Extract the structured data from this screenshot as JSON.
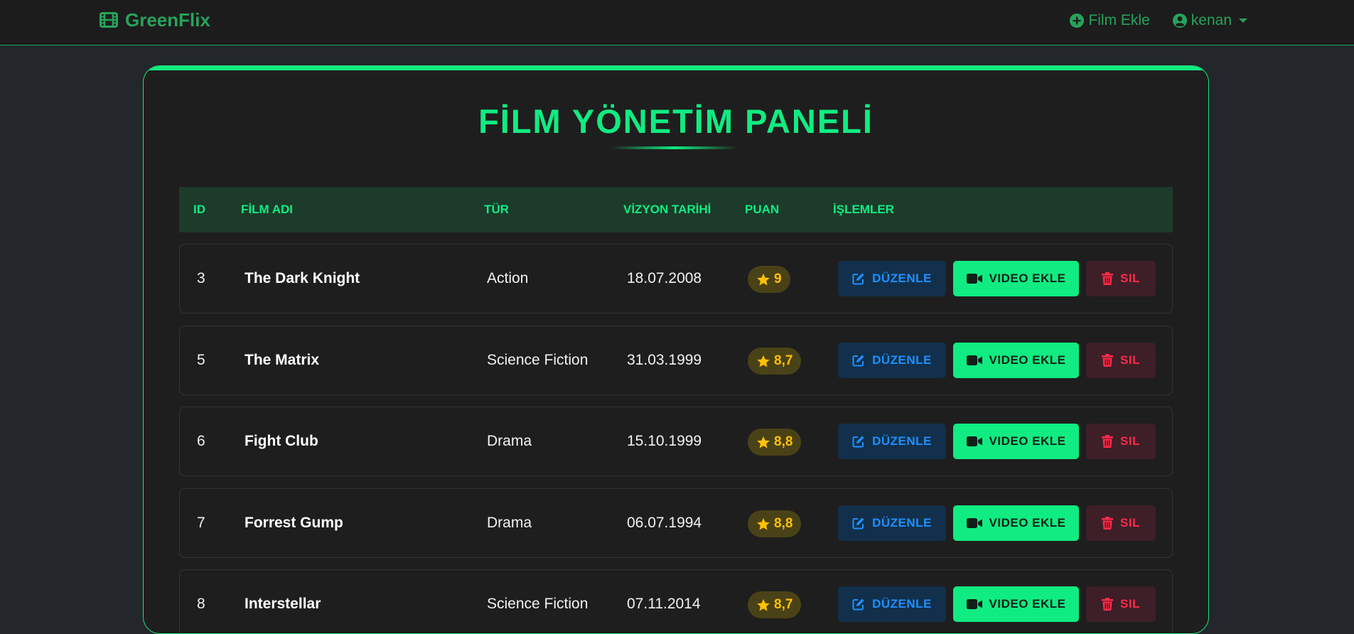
{
  "navbar": {
    "brand": "GreenFlix",
    "add_film": "Film Ekle",
    "user": "kenan"
  },
  "page": {
    "title": "FİLM YÖNETİM PANELİ"
  },
  "table": {
    "headers": {
      "id": "ID",
      "name": "FİLM ADI",
      "genre": "TÜR",
      "release": "VİZYON TARİHİ",
      "rating": "PUAN",
      "actions": "İŞLEMLER"
    },
    "actions": {
      "edit": "DÜZENLE",
      "video": "VIDEO EKLE",
      "delete": "SIL"
    },
    "rows": [
      {
        "id": "3",
        "name": "The Dark Knight",
        "genre": "Action",
        "release": "18.07.2008",
        "rating": "9"
      },
      {
        "id": "5",
        "name": "The Matrix",
        "genre": "Science Fiction",
        "release": "31.03.1999",
        "rating": "8,7"
      },
      {
        "id": "6",
        "name": "Fight Club",
        "genre": "Drama",
        "release": "15.10.1999",
        "rating": "8,8"
      },
      {
        "id": "7",
        "name": "Forrest Gump",
        "genre": "Drama",
        "release": "06.07.1994",
        "rating": "8,8"
      },
      {
        "id": "8",
        "name": "Interstellar",
        "genre": "Science Fiction",
        "release": "07.11.2014",
        "rating": "8,7"
      }
    ]
  },
  "colors": {
    "accent": "#10ec81",
    "brand": "#27a35b",
    "edit": "#1e90ff",
    "delete": "#ff2b4a",
    "rating": "#ffc107"
  },
  "icons": {
    "brand": "film-icon",
    "add": "plus-circle-icon",
    "user": "user-circle-icon",
    "rating": "star-icon",
    "edit": "edit-icon",
    "video": "video-camera-icon",
    "delete": "trash-icon"
  }
}
